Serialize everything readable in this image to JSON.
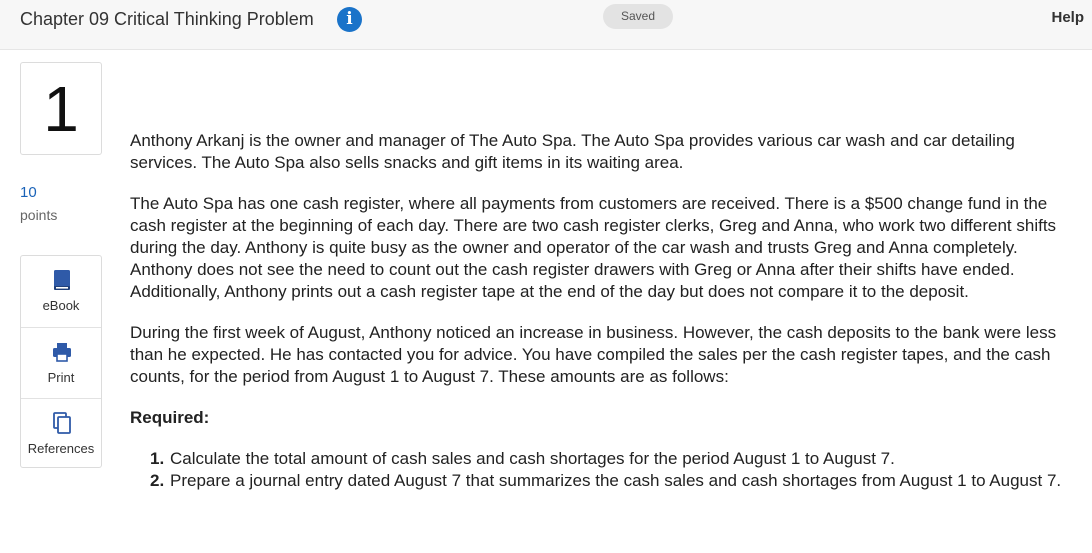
{
  "header": {
    "title": "Chapter 09 Critical Thinking Problem",
    "info_icon": "info-icon",
    "saved_label": "Saved",
    "help_label": "Help"
  },
  "question": {
    "number": "1",
    "points_value": "10",
    "points_label": "points"
  },
  "tools": [
    {
      "label": "eBook",
      "icon": "book-icon"
    },
    {
      "label": "Print",
      "icon": "printer-icon"
    },
    {
      "label": "References",
      "icon": "copy-pages-icon"
    }
  ],
  "content": {
    "paragraphs": [
      "Anthony Arkanj is the owner and manager of The Auto Spa. The Auto Spa provides various car wash and car detailing services. The Auto Spa also sells snacks and gift items in its waiting area.",
      "The Auto Spa has one cash register, where all payments from customers are received. There is a $500 change fund in the cash register at the beginning of each day. There are two cash register clerks, Greg and Anna, who work two different shifts during the day. Anthony is quite busy as the owner and operator of the car wash and trusts Greg and Anna completely. Anthony does not see the need to count out the cash register drawers with Greg or Anna after their shifts have ended. Additionally, Anthony prints out a cash register tape at the end of the day but does not compare it to the deposit.",
      "During the first week of August, Anthony noticed an increase in business. However, the cash deposits to the bank were less than he expected. He has contacted you for advice. You have compiled the sales per the cash register tapes, and the cash counts, for the period from August 1 to August 7. These amounts are as follows:"
    ],
    "required_heading": "Required:",
    "requirements": [
      {
        "num": "1.",
        "text": "Calculate the total amount of cash sales and cash shortages for the period August 1 to August 7."
      },
      {
        "num": "2.",
        "text": "Prepare a journal entry dated August 7 that summarizes the cash sales and cash shortages from August 1 to August 7."
      }
    ]
  },
  "colors": {
    "accent_blue": "#1a73c9",
    "points_blue": "#1a63b8",
    "icon_blue": "#2f5aa8"
  }
}
